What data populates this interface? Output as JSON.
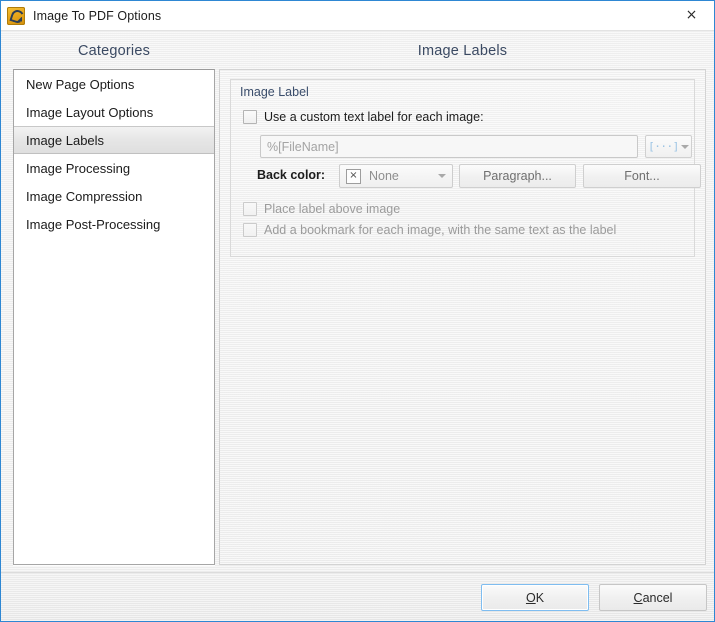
{
  "window": {
    "title": "Image To PDF Options",
    "icon": "app-icon",
    "close_label": "×",
    "accent_border": "#2e87d3"
  },
  "categories": {
    "heading": "Categories",
    "items": [
      {
        "label": "New Page Options",
        "selected": false
      },
      {
        "label": "Image Layout Options",
        "selected": false
      },
      {
        "label": "Image Labels",
        "selected": true
      },
      {
        "label": "Image Processing",
        "selected": false
      },
      {
        "label": "Image Compression",
        "selected": false
      },
      {
        "label": "Image Post-Processing",
        "selected": false
      }
    ]
  },
  "main": {
    "heading": "Image Labels",
    "group": {
      "title": "Image Label",
      "use_custom_label": {
        "label": "Use a custom text label for each image:",
        "checked": false,
        "enabled": true
      },
      "label_text_field": {
        "value": "%[FileName]",
        "placeholder": "%[FileName]",
        "enabled": false
      },
      "macro_button": {
        "glyph": "[···]",
        "has_dropdown": true
      },
      "back_color": {
        "label": "Back color:",
        "value": "None",
        "swatch_glyph": "×"
      },
      "paragraph_button": "Paragraph...",
      "font_button": "Font...",
      "place_label_above": {
        "label": "Place label above image",
        "checked": false,
        "enabled": false
      },
      "add_bookmark": {
        "label": "Add a bookmark for each image, with the same text as the label",
        "checked": false,
        "enabled": false
      }
    }
  },
  "footer": {
    "ok": {
      "pre": "",
      "accel": "O",
      "post": "K"
    },
    "cancel": {
      "pre": "",
      "accel": "C",
      "post": "ancel"
    }
  }
}
